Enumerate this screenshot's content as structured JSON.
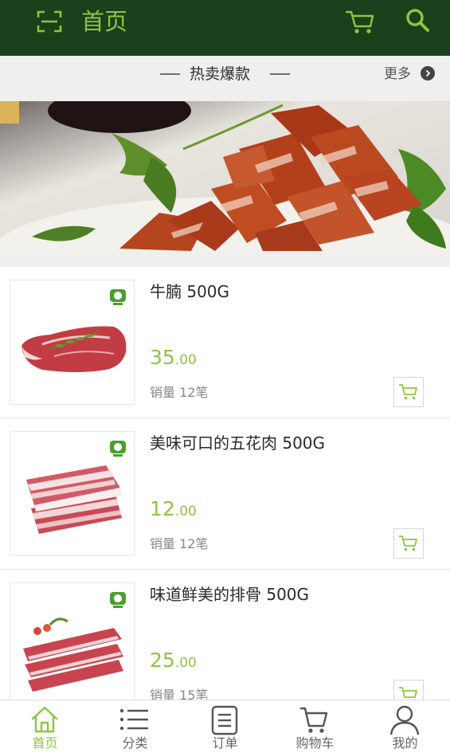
{
  "header": {
    "title": "首页",
    "scan_icon": "scan-icon",
    "cart_icon": "cart-icon",
    "search_icon": "search-icon"
  },
  "section": {
    "title": "热卖爆款",
    "more_label": "更多"
  },
  "banner": {
    "image": "roast-pork-banner"
  },
  "products": [
    {
      "name": "牛腩  500G",
      "price_int": "35",
      "price_dec": ".00",
      "sales": "销量 12笔"
    },
    {
      "name": "美味可口的五花肉  500G",
      "price_int": "12",
      "price_dec": ".00",
      "sales": "销量 12笔"
    },
    {
      "name": "味道鲜美的排骨  500G",
      "price_int": "25",
      "price_dec": ".00",
      "sales": "销量 15笔"
    }
  ],
  "tabs": [
    {
      "label": "首页",
      "icon": "home-icon",
      "active": true
    },
    {
      "label": "分类",
      "icon": "list-icon",
      "active": false
    },
    {
      "label": "订单",
      "icon": "order-icon",
      "active": false
    },
    {
      "label": "购物车",
      "icon": "cart-icon",
      "active": false
    },
    {
      "label": "我的",
      "icon": "user-icon",
      "active": false
    }
  ],
  "colors": {
    "header_bg": "#1b401c",
    "accent": "#8cc63f"
  }
}
